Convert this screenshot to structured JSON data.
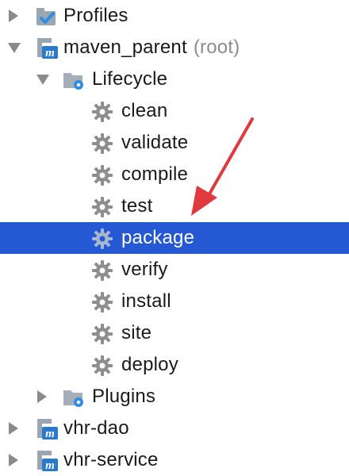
{
  "tree": {
    "profiles": {
      "label": "Profiles",
      "icon": "profiles-check-icon"
    },
    "maven_parent": {
      "label": "maven_parent",
      "suffix": "(root)",
      "icon": "maven-module-icon"
    },
    "lifecycle": {
      "label": "Lifecycle",
      "icon": "lifecycle-folder-icon",
      "phases": [
        "clean",
        "validate",
        "compile",
        "test",
        "package",
        "verify",
        "install",
        "site",
        "deploy"
      ],
      "selected": "package"
    },
    "plugins": {
      "label": "Plugins",
      "icon": "plugins-folder-icon"
    },
    "modules": [
      {
        "label": "vhr-dao",
        "icon": "maven-module-icon"
      },
      {
        "label": "vhr-service",
        "icon": "maven-module-icon"
      }
    ]
  },
  "colors": {
    "selection": "#2558d3",
    "annotation_arrow": "#e0393e",
    "gear": "#8e8e8e",
    "maven_blue": "#2a7ac9"
  }
}
